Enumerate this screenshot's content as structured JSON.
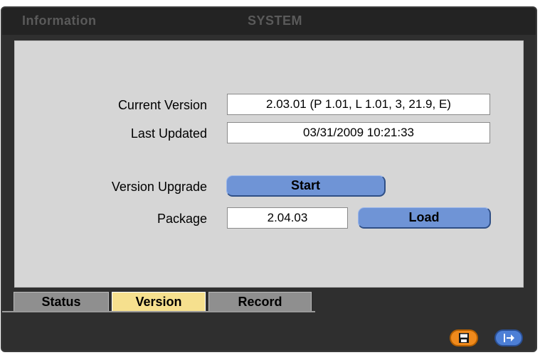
{
  "window": {
    "section_title": "Information",
    "page_title": "SYSTEM"
  },
  "version_info": {
    "current_version_label": "Current Version",
    "current_version_value": "2.03.01 (P 1.01,  L 1.01,  3,  21.9, E)",
    "last_updated_label": "Last Updated",
    "last_updated_value": "03/31/2009  10:21:33"
  },
  "upgrade": {
    "version_upgrade_label": "Version Upgrade",
    "start_button": "Start",
    "package_label": "Package",
    "package_value": "2.04.03",
    "load_button": "Load"
  },
  "tabs": [
    {
      "label": "Status",
      "active": false
    },
    {
      "label": "Version",
      "active": true
    },
    {
      "label": "Record",
      "active": false
    }
  ],
  "footer": {
    "save_icon": "floppy-disk-icon",
    "exit_icon": "exit-arrow-icon"
  },
  "colors": {
    "panel_bg": "#d6d6d6",
    "button_blue": "#6f94d6",
    "tab_active": "#f6e08e",
    "tab_inactive": "#8f8f8f",
    "save_orange": "#f08a1c",
    "exit_blue": "#4d7fd6"
  }
}
